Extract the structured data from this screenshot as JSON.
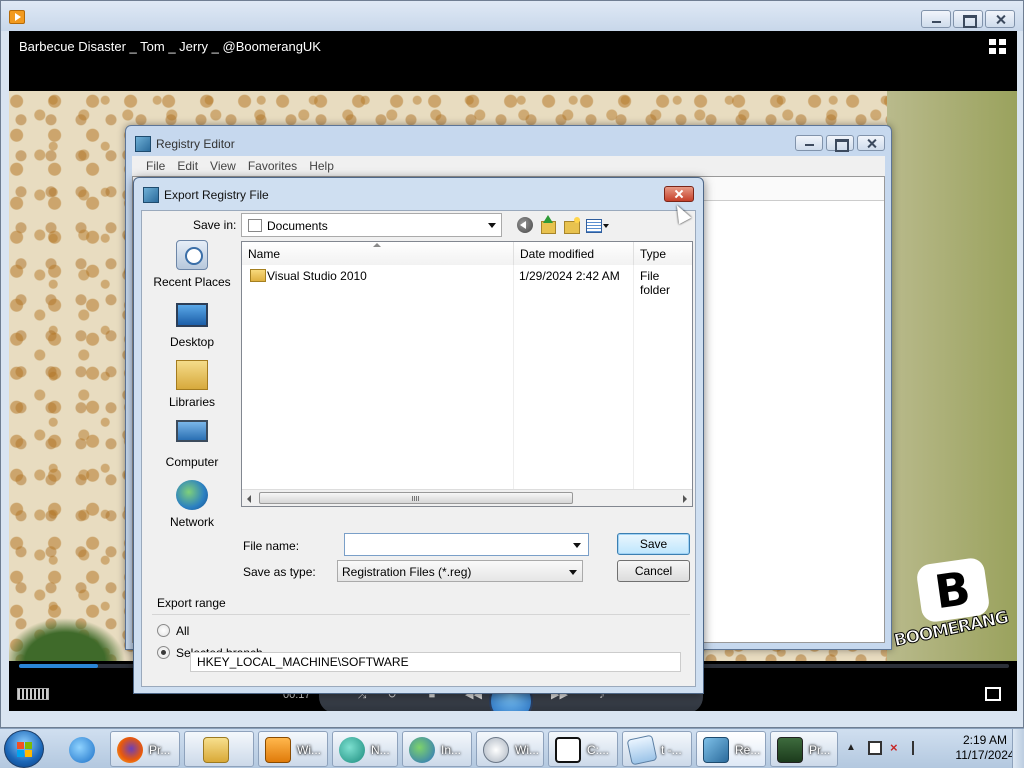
{
  "player": {
    "video_title": "Barbecue Disaster _ Tom _ Jerry _ @BoomerangUK",
    "logo_text": "BOOMERANG",
    "elapsed_time": "00:17",
    "progress_fraction": 0.08
  },
  "regedit": {
    "title": "Registry Editor",
    "menu": [
      "File",
      "Edit",
      "View",
      "Favorites",
      "Help"
    ]
  },
  "dialog": {
    "title": "Export Registry File",
    "save_in_label": "Save in:",
    "save_in_value": "Documents",
    "places": [
      {
        "label": "Recent Places",
        "icon": "recent-places-icon"
      },
      {
        "label": "Desktop",
        "icon": "desktop-icon"
      },
      {
        "label": "Libraries",
        "icon": "libraries-icon"
      },
      {
        "label": "Computer",
        "icon": "computer-icon"
      },
      {
        "label": "Network",
        "icon": "network-icon"
      }
    ],
    "columns": [
      "Name",
      "Date modified",
      "Type"
    ],
    "files": [
      {
        "name": "Visual Studio 2010",
        "date_modified": "1/29/2024 2:42 AM",
        "type": "File folder"
      }
    ],
    "file_name_label": "File name:",
    "file_name_value": "",
    "save_as_type_label": "Save as type:",
    "save_as_type_value": "Registration Files (*.reg)",
    "save_button": "Save",
    "cancel_button": "Cancel",
    "export_range": {
      "title": "Export range",
      "option_all": "All",
      "option_selected": "Selected branch",
      "selected": "Selected branch",
      "branch_value": "HKEY_LOCAL_MACHINE\\SOFTWARE"
    }
  },
  "taskbar": {
    "items": [
      {
        "label": "",
        "icon": "internet-explorer-icon"
      },
      {
        "label": "Pr...",
        "icon": "firefox-icon"
      },
      {
        "label": "",
        "icon": "explorer-folder-icon"
      },
      {
        "label": "Wi...",
        "icon": "media-player-icon"
      },
      {
        "label": "N...",
        "icon": "network-app-icon"
      },
      {
        "label": "In...",
        "icon": "download-manager-icon"
      },
      {
        "label": "Wi...",
        "icon": "windows-app-icon"
      },
      {
        "label": "C:...",
        "icon": "7zip-icon"
      },
      {
        "label": "t -...",
        "icon": "notepad-icon"
      },
      {
        "label": "Re...",
        "icon": "regedit-icon"
      },
      {
        "label": "Pr...",
        "icon": "process-icon"
      }
    ],
    "clock_time": "2:19 AM",
    "clock_date": "11/17/2024"
  },
  "colors": {
    "accent": "#2a84d6",
    "taskbar": "#c3d4e8",
    "dialog_frame": "#cfdff1"
  }
}
